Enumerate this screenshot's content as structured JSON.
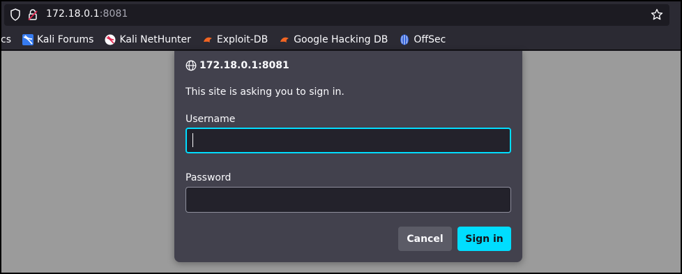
{
  "browser": {
    "url_host": "172.18.0.1",
    "url_port": ":8081",
    "icons": {
      "shield": "shield-icon",
      "lock": "insecure-lock-icon",
      "star": "bookmark-star-icon"
    }
  },
  "bookmarks": [
    {
      "label": "cs",
      "icon": "docs-icon"
    },
    {
      "label": "Kali Forums",
      "icon": "kali-icon"
    },
    {
      "label": "Kali NetHunter",
      "icon": "kali-nethunter-icon"
    },
    {
      "label": "Exploit-DB",
      "icon": "exploit-db-icon"
    },
    {
      "label": "Google Hacking DB",
      "icon": "exploit-db-icon"
    },
    {
      "label": "OffSec",
      "icon": "offsec-icon"
    }
  ],
  "dialog": {
    "title": "172.18.0.1:8081",
    "message": "This site is asking you to sign in.",
    "username_label": "Username",
    "username_value": "",
    "password_label": "Password",
    "password_value": "",
    "cancel_label": "Cancel",
    "signin_label": "Sign in"
  },
  "colors": {
    "accent": "#00ddff",
    "dialog_bg": "#42414d",
    "toolbar_bg": "#2b2a33",
    "page_bg": "#9b9b9b"
  }
}
